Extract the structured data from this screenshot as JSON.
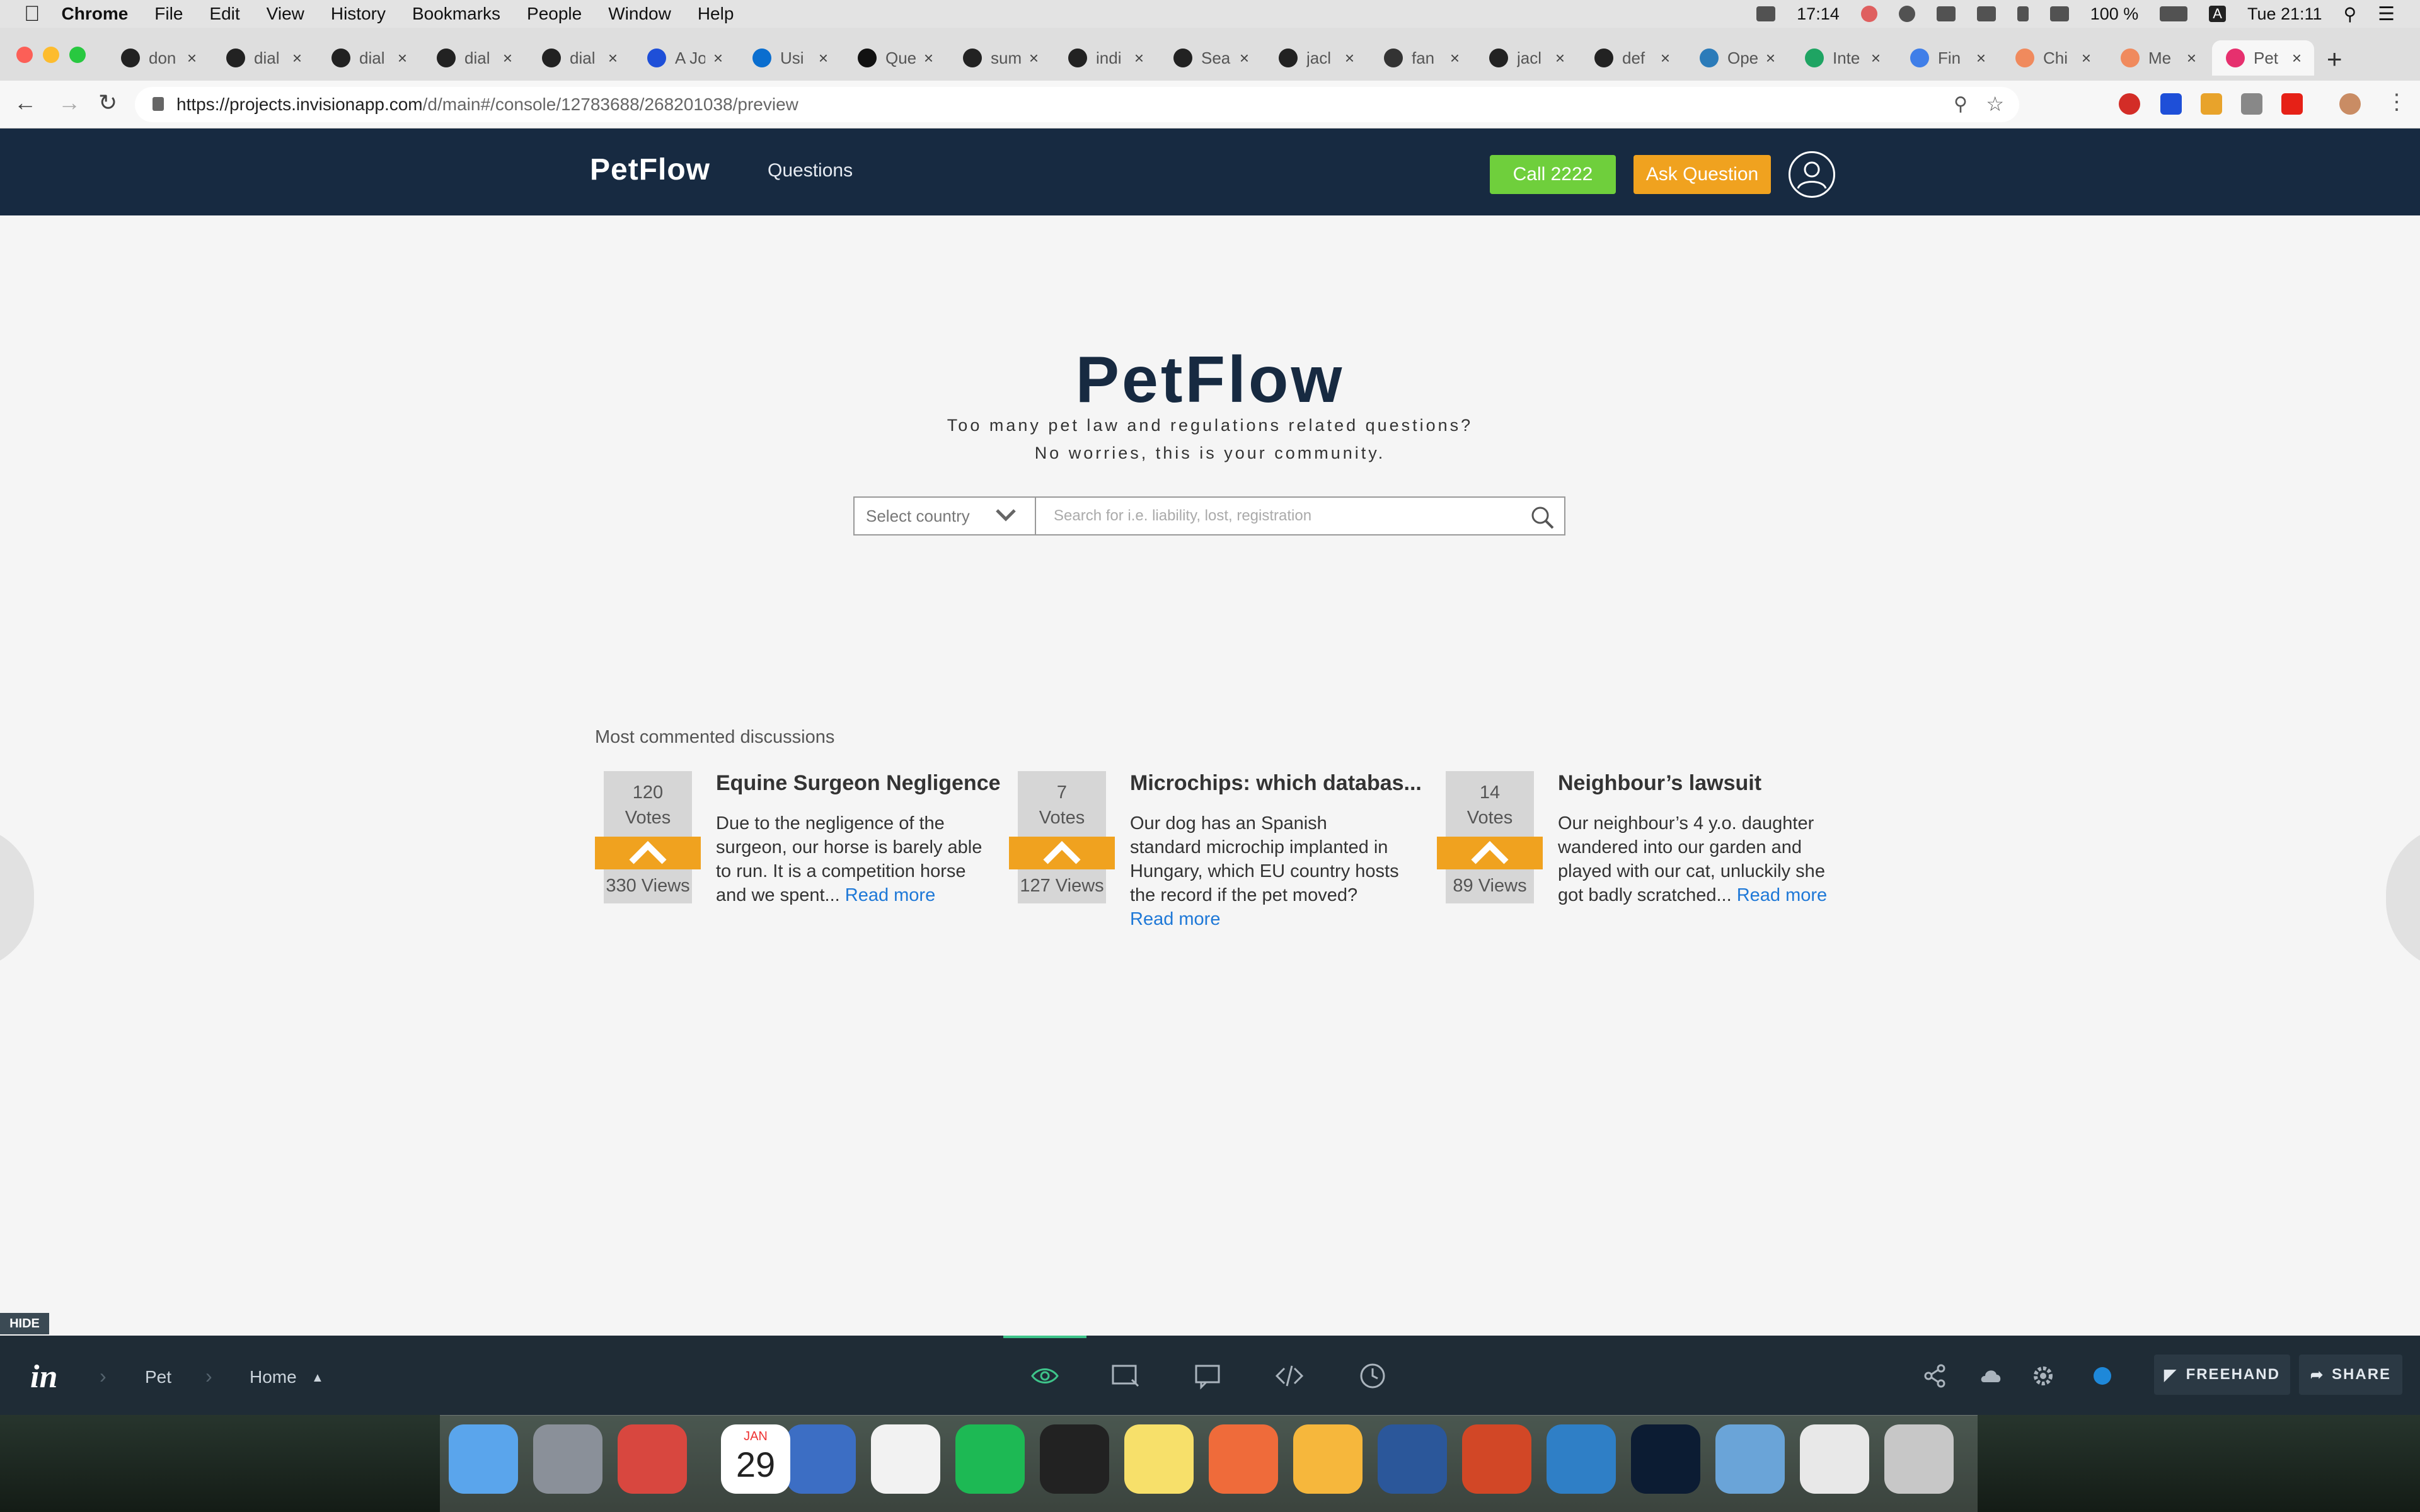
{
  "menubar": {
    "app_name": "Chrome",
    "items": [
      "File",
      "Edit",
      "View",
      "History",
      "Bookmarks",
      "People",
      "Window",
      "Help"
    ],
    "time_left": "17:14",
    "battery": "100 %",
    "input_source": "A",
    "datetime": "Tue 21:11"
  },
  "browser": {
    "tabs": [
      {
        "label": "don",
        "icon": "github-icon"
      },
      {
        "label": "dial",
        "icon": "github-icon"
      },
      {
        "label": "dial",
        "icon": "github-icon"
      },
      {
        "label": "dial",
        "icon": "github-icon"
      },
      {
        "label": "dial",
        "icon": "github-icon"
      },
      {
        "label": "A Jo",
        "icon": "a-icon"
      },
      {
        "label": "Usi",
        "icon": "intel-icon"
      },
      {
        "label": "Que",
        "icon": "medium-icon"
      },
      {
        "label": "sum",
        "icon": "github-icon"
      },
      {
        "label": "indi",
        "icon": "github-icon"
      },
      {
        "label": "Sea",
        "icon": "github-icon"
      },
      {
        "label": "jacl",
        "icon": "github-icon"
      },
      {
        "label": "fan",
        "icon": "stack-icon"
      },
      {
        "label": "jacl",
        "icon": "github-icon"
      },
      {
        "label": "def",
        "icon": "github-icon"
      },
      {
        "label": "Ope",
        "icon": "wordpress-icon"
      },
      {
        "label": "Inte",
        "icon": "sheets-icon"
      },
      {
        "label": "Fin",
        "icon": "docs-icon"
      },
      {
        "label": "Chi",
        "icon": "app-icon"
      },
      {
        "label": "Me",
        "icon": "app-icon"
      },
      {
        "label": "Pet",
        "icon": "invision-icon",
        "active": true
      }
    ],
    "url": "https://projects.invisionapp.com/d/main#/console/12783688/268201038/preview",
    "url_host": "https://projects.invisionapp.com",
    "url_path": "/d/main#/console/12783688/268201038/preview"
  },
  "app": {
    "brand": "PetFlow",
    "nav_questions": "Questions",
    "call_button": "Call 2222",
    "ask_button": "Ask Question",
    "hero_title": "PetFlow",
    "tagline_1": "Too many pet law and regulations related questions?",
    "tagline_2": "No worries, this is your community.",
    "country_select": "Select country",
    "search_placeholder": "Search for i.e. liability, lost, registration",
    "section_title": "Most commented discussions",
    "discussions": [
      {
        "votes": "120",
        "votes_label": "Votes",
        "views": "330 Views",
        "title": "Equine Surgeon Negligence",
        "body": "Due to the negligence of the surgeon, our horse is barely able to run. It is a competition horse and we spent...",
        "read_more": "Read more"
      },
      {
        "votes": "7",
        "votes_label": "Votes",
        "views": "127 Views",
        "title": "Microchips: which databas...",
        "body": "Our dog has an Spanish standard microchip implanted in Hungary, which EU country hosts the record if the pet moved?",
        "read_more": "Read more"
      },
      {
        "votes": "14",
        "votes_label": "Votes",
        "views": "89 Views",
        "title": "Neighbour’s lawsuit",
        "body": "Our neighbour’s 4 y.o. daughter wandered into our garden and played with our cat, unluckily she got badly scratched...",
        "read_more": "Read more"
      }
    ]
  },
  "invision": {
    "hide": "HIDE",
    "logo": "in",
    "crumb_project": "Pet",
    "crumb_screen": "Home",
    "freehand": "FREEHAND",
    "share": "SHARE"
  },
  "dock": {
    "calendar_month": "JAN",
    "calendar_day": "29",
    "apps": [
      "finder-icon",
      "launchpad-icon",
      "wunderlist-icon",
      "calendar-icon",
      "vpn-icon",
      "chrome-icon",
      "spotify-icon",
      "terminal-icon",
      "notes-icon",
      "postman-icon",
      "sketch-icon",
      "word-icon",
      "powerpoint-icon",
      "vscode-icon",
      "photoshop-icon",
      "quicktime-icon",
      "document-icon",
      "trash-icon"
    ]
  },
  "colors": {
    "navbar": "#172a41",
    "call_green": "#6fcf3c",
    "ask_orange": "#f0a21f",
    "link_blue": "#1e78d7",
    "vote_grey": "#d6d6d6"
  }
}
